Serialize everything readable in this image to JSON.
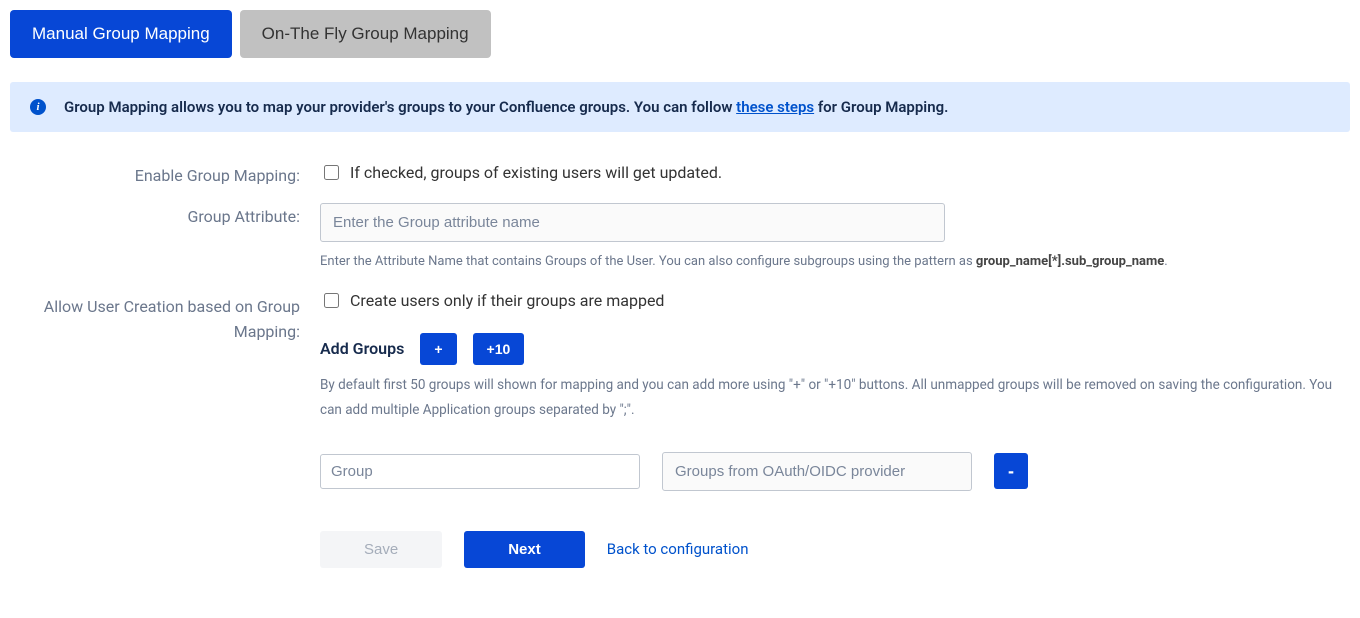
{
  "tabs": {
    "manual": "Manual Group Mapping",
    "onthefly": "On-The Fly Group Mapping"
  },
  "banner": {
    "prefix": "Group Mapping allows you to map your provider's groups to your Confluence groups. You can follow ",
    "link": "these steps",
    "suffix": " for Group Mapping."
  },
  "labels": {
    "enable": "Enable Group Mapping:",
    "attribute": "Group Attribute:",
    "allowCreate": "Allow User Creation based on Group Mapping:"
  },
  "enable": {
    "text": "If checked, groups of existing users will get updated."
  },
  "attribute": {
    "placeholder": "Enter the Group attribute name",
    "helpPrefix": "Enter the Attribute Name that contains Groups of the User. You can also configure subgroups using the pattern as ",
    "helpBold": "group_name[*].sub_group_name",
    "helpSuffix": "."
  },
  "allowCreate": {
    "text": "Create users only if their groups are mapped"
  },
  "addGroups": {
    "label": "Add Groups",
    "plus": "+",
    "plus10": "+10",
    "help": "By default first 50 groups will shown for mapping and you can add more using \"+\" or \"+10\" buttons. All unmapped groups will be removed on saving the configuration. You can add multiple Application groups separated by \";\"."
  },
  "groupRow": {
    "groupPlaceholder": "Group",
    "providerPlaceholder": "Groups from OAuth/OIDC provider",
    "minus": "-"
  },
  "buttons": {
    "save": "Save",
    "next": "Next",
    "back": "Back to configuration"
  }
}
